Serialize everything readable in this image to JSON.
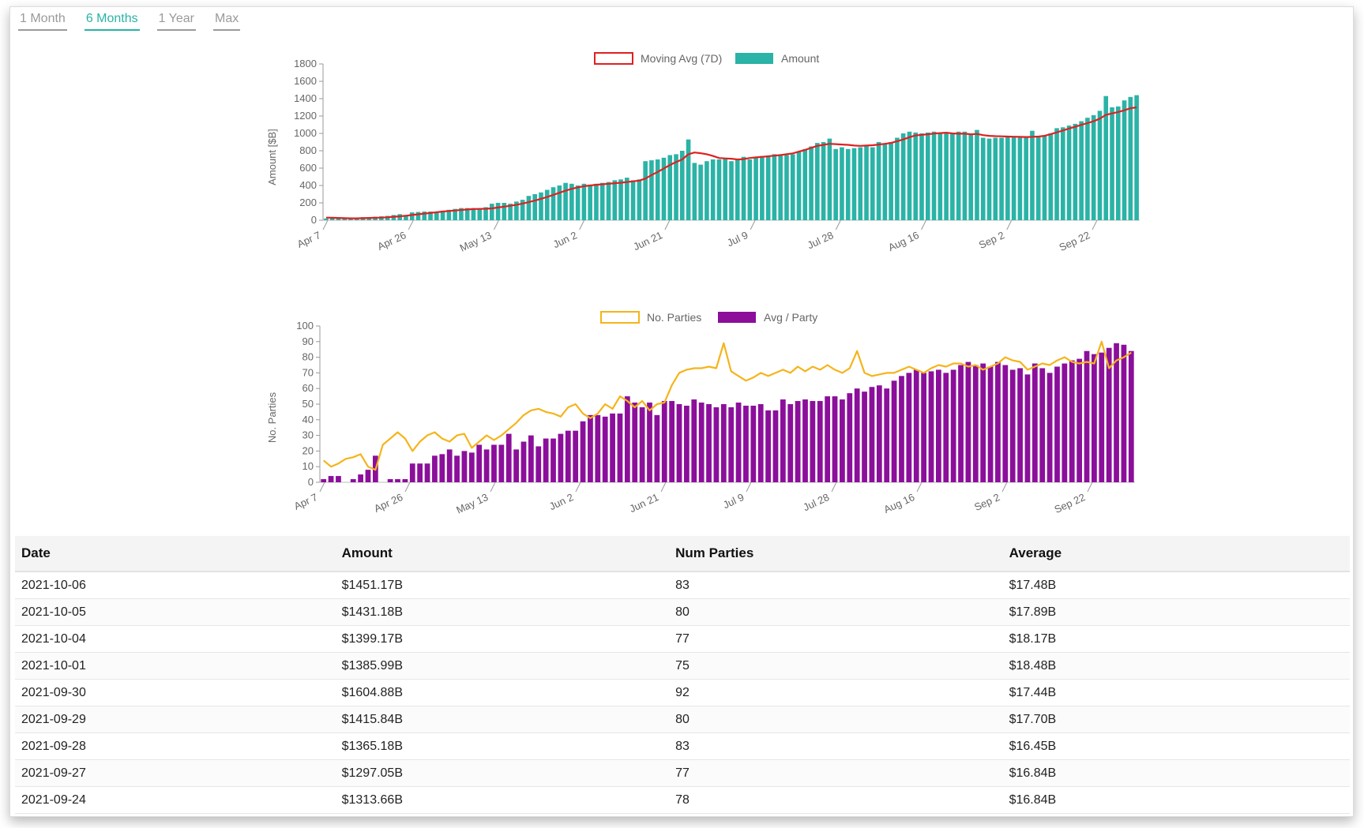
{
  "range_tabs": [
    {
      "label": "1 Month",
      "active": false
    },
    {
      "label": "6 Months",
      "active": true
    },
    {
      "label": "1 Year",
      "active": false
    },
    {
      "label": "Max",
      "active": false
    }
  ],
  "colors": {
    "amount_bar": "#2ab3a6",
    "moving_avg": "#e02020",
    "avg_party_bar": "#8b0f9b",
    "parties_line": "#f5b41a",
    "active_tab": "#2ab3a6"
  },
  "chart_data": [
    {
      "type": "bar",
      "legend": [
        "Moving Avg (7D)",
        "Amount"
      ],
      "ylabel": "Amount [$B]",
      "ylim": [
        0,
        1800
      ],
      "yticks": [
        0,
        200,
        400,
        600,
        800,
        1000,
        1200,
        1400,
        1600,
        1800
      ],
      "xticklabels": [
        "Apr 7",
        "Apr 26",
        "May 13",
        "Jun 2",
        "Jun 21",
        "Jul 9",
        "Jul 28",
        "Aug 16",
        "Sep 2",
        "Sep 22"
      ],
      "series": [
        {
          "name": "Amount",
          "kind": "bar",
          "values": [
            20,
            25,
            20,
            25,
            30,
            30,
            35,
            35,
            40,
            45,
            50,
            60,
            70,
            60,
            90,
            95,
            100,
            100,
            95,
            110,
            120,
            130,
            140,
            140,
            140,
            140,
            150,
            190,
            200,
            200,
            190,
            215,
            235,
            280,
            300,
            320,
            350,
            380,
            400,
            430,
            420,
            400,
            420,
            410,
            420,
            430,
            440,
            460,
            470,
            490,
            460,
            470,
            680,
            690,
            700,
            720,
            750,
            760,
            800,
            930,
            660,
            640,
            680,
            700,
            700,
            710,
            680,
            700,
            730,
            700,
            720,
            740,
            730,
            760,
            760,
            750,
            760,
            790,
            820,
            850,
            890,
            900,
            940,
            820,
            840,
            820,
            830,
            840,
            850,
            840,
            900,
            880,
            900,
            950,
            1000,
            1020,
            1010,
            1000,
            1010,
            1020,
            1000,
            1000,
            1000,
            1020,
            1020,
            1000,
            1040,
            950,
            940,
            950,
            950,
            960,
            960,
            950,
            960,
            1030,
            970,
            980,
            1000,
            1060,
            1070,
            1090,
            1110,
            1140,
            1180,
            1210,
            1260,
            1430,
            1300,
            1310,
            1380,
            1420,
            1440
          ]
        },
        {
          "name": "Moving Avg (7D)",
          "kind": "line",
          "values": [
            30,
            28,
            26,
            24,
            22,
            22,
            24,
            26,
            28,
            30,
            34,
            40,
            45,
            52,
            60,
            68,
            76,
            84,
            92,
            100,
            106,
            112,
            118,
            124,
            128,
            130,
            132,
            136,
            146,
            156,
            166,
            178,
            192,
            208,
            226,
            246,
            268,
            292,
            316,
            340,
            362,
            378,
            392,
            400,
            408,
            414,
            420,
            426,
            432,
            440,
            448,
            456,
            480,
            520,
            556,
            596,
            636,
            670,
            700,
            760,
            780,
            772,
            760,
            740,
            716,
            712,
            708,
            700,
            704,
            716,
            724,
            730,
            736,
            744,
            750,
            760,
            770,
            790,
            810,
            834,
            856,
            868,
            880,
            876,
            872,
            868,
            860,
            856,
            860,
            864,
            872,
            880,
            890,
            910,
            930,
            956,
            976,
            984,
            990,
            998,
            1004,
            1008,
            1000,
            996,
            996,
            990,
            994,
            980,
            972,
            968,
            966,
            964,
            962,
            960,
            958,
            960,
            964,
            972,
            992,
            1012,
            1034,
            1056,
            1076,
            1098,
            1118,
            1140,
            1170,
            1214,
            1230,
            1246,
            1266,
            1290,
            1300
          ]
        }
      ]
    },
    {
      "type": "bar",
      "legend": [
        "No. Parties",
        "Avg / Party"
      ],
      "ylabel": "No. Parties",
      "ylim": [
        0,
        100
      ],
      "yticks": [
        0,
        10,
        20,
        30,
        40,
        50,
        60,
        70,
        80,
        90,
        100
      ],
      "xticklabels": [
        "Apr 7",
        "Apr 26",
        "May 13",
        "Jun 2",
        "Jun 21",
        "Jul 9",
        "Jul 28",
        "Aug 16",
        "Sep 2",
        "Sep 22"
      ],
      "series": [
        {
          "name": "Avg / Party",
          "kind": "bar",
          "values": [
            2,
            4,
            4,
            0,
            2,
            5,
            8,
            17,
            0,
            2,
            2,
            2,
            12,
            12,
            12,
            17,
            18,
            21,
            17,
            20,
            19,
            24,
            21,
            24,
            24,
            31,
            21,
            26,
            30,
            23,
            28,
            28,
            31,
            33,
            33,
            39,
            43,
            43,
            42,
            44,
            44,
            55,
            51,
            48,
            51,
            43,
            52,
            52,
            50,
            49,
            53,
            51,
            50,
            48,
            50,
            48,
            51,
            49,
            49,
            50,
            46,
            46,
            53,
            50,
            52,
            53,
            52,
            52,
            55,
            55,
            53,
            57,
            60,
            58,
            61,
            62,
            60,
            65,
            68,
            70,
            72,
            70,
            71,
            72,
            70,
            72,
            75,
            77,
            75,
            76,
            74,
            77,
            75,
            72,
            73,
            69,
            76,
            73,
            70,
            74,
            76,
            78,
            79,
            84,
            82,
            83,
            86,
            89,
            88,
            84
          ]
        },
        {
          "name": "No. Parties",
          "kind": "line",
          "values": [
            14,
            10,
            12,
            15,
            16,
            18,
            10,
            8,
            24,
            28,
            32,
            28,
            20,
            26,
            30,
            32,
            28,
            26,
            30,
            31,
            22,
            26,
            30,
            27,
            30,
            34,
            38,
            43,
            46,
            47,
            45,
            44,
            42,
            48,
            50,
            44,
            41,
            44,
            50,
            47,
            55,
            52,
            48,
            52,
            46,
            50,
            51,
            62,
            70,
            72,
            73,
            73,
            74,
            73,
            89,
            71,
            68,
            65,
            67,
            70,
            68,
            70,
            72,
            70,
            74,
            71,
            74,
            72,
            75,
            72,
            70,
            73,
            84,
            70,
            68,
            69,
            70,
            70,
            72,
            74,
            72,
            70,
            73,
            75,
            74,
            76,
            76,
            74,
            75,
            72,
            74,
            76,
            80,
            78,
            77,
            72,
            74,
            76,
            75,
            78,
            80,
            77,
            76,
            77,
            76,
            90,
            73,
            78,
            80,
            83
          ]
        }
      ]
    }
  ],
  "table": {
    "headers": [
      "Date",
      "Amount",
      "Num Parties",
      "Average"
    ],
    "rows": [
      [
        "2021-10-06",
        "$1451.17B",
        "83",
        "$17.48B"
      ],
      [
        "2021-10-05",
        "$1431.18B",
        "80",
        "$17.89B"
      ],
      [
        "2021-10-04",
        "$1399.17B",
        "77",
        "$18.17B"
      ],
      [
        "2021-10-01",
        "$1385.99B",
        "75",
        "$18.48B"
      ],
      [
        "2021-09-30",
        "$1604.88B",
        "92",
        "$17.44B"
      ],
      [
        "2021-09-29",
        "$1415.84B",
        "80",
        "$17.70B"
      ],
      [
        "2021-09-28",
        "$1365.18B",
        "83",
        "$16.45B"
      ],
      [
        "2021-09-27",
        "$1297.05B",
        "77",
        "$16.84B"
      ],
      [
        "2021-09-24",
        "$1313.66B",
        "78",
        "$16.84B"
      ]
    ]
  }
}
